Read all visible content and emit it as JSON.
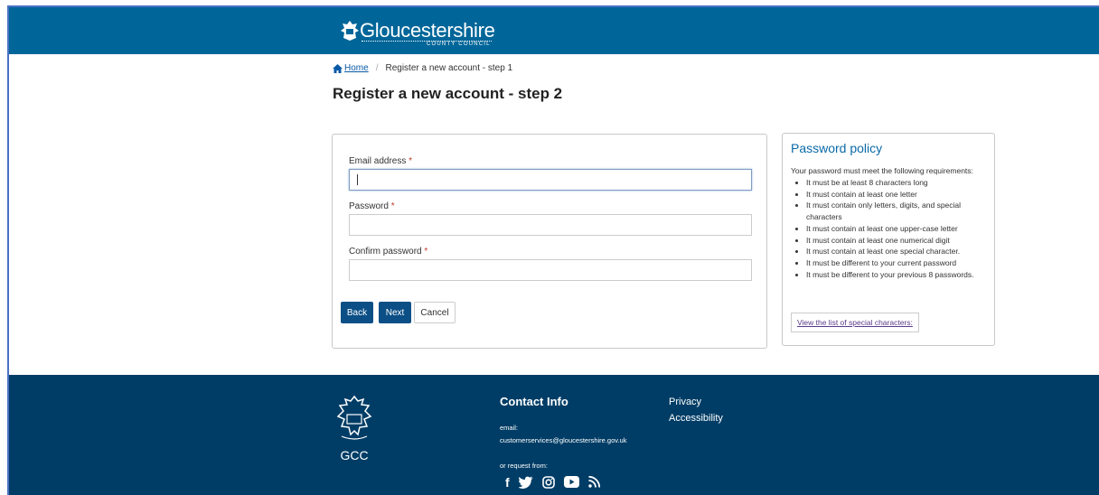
{
  "header": {
    "logo_text": "Gloucestershire",
    "logo_subtext": "COUNTY COUNCIL",
    "bg_color": "#006699"
  },
  "breadcrumb": {
    "home_label": "Home",
    "current_label": "Register a new account - step 1",
    "separator": "/"
  },
  "page": {
    "title": "Register a new account - step 2"
  },
  "form": {
    "email_label": "Email address",
    "password_label": "Password",
    "confirm_label": "Confirm password",
    "required_marker": "*",
    "email_value": "",
    "password_value": "",
    "confirm_value": "",
    "back_label": "Back",
    "next_label": "Next",
    "cancel_label": "Cancel"
  },
  "policy": {
    "title": "Password policy",
    "intro": "Your password must meet the following requirements:",
    "rules": [
      "It must be at least 8 characters long",
      "It must contain at least one letter",
      "It must contain only letters, digits, and special characters",
      "It must contain at least one upper-case letter",
      "It must contain at least one numerical digit",
      "It must contain at least one special character.",
      "It must be different to your current password",
      "It must be different to your previous 8 passwords."
    ],
    "special_chars_link": "View the list of special characters:"
  },
  "footer": {
    "crest_text": "GCC",
    "contact_title": "Contact Info",
    "email_label": "email:",
    "email_value": "customerservices@gloucestershire.gov.uk",
    "request_label": "or request from:",
    "links": [
      "Privacy",
      "Accessibility"
    ],
    "social_icons": [
      "facebook-icon",
      "twitter-icon",
      "instagram-icon",
      "youtube-icon",
      "rss-icon"
    ],
    "bg_color": "#003d66"
  }
}
